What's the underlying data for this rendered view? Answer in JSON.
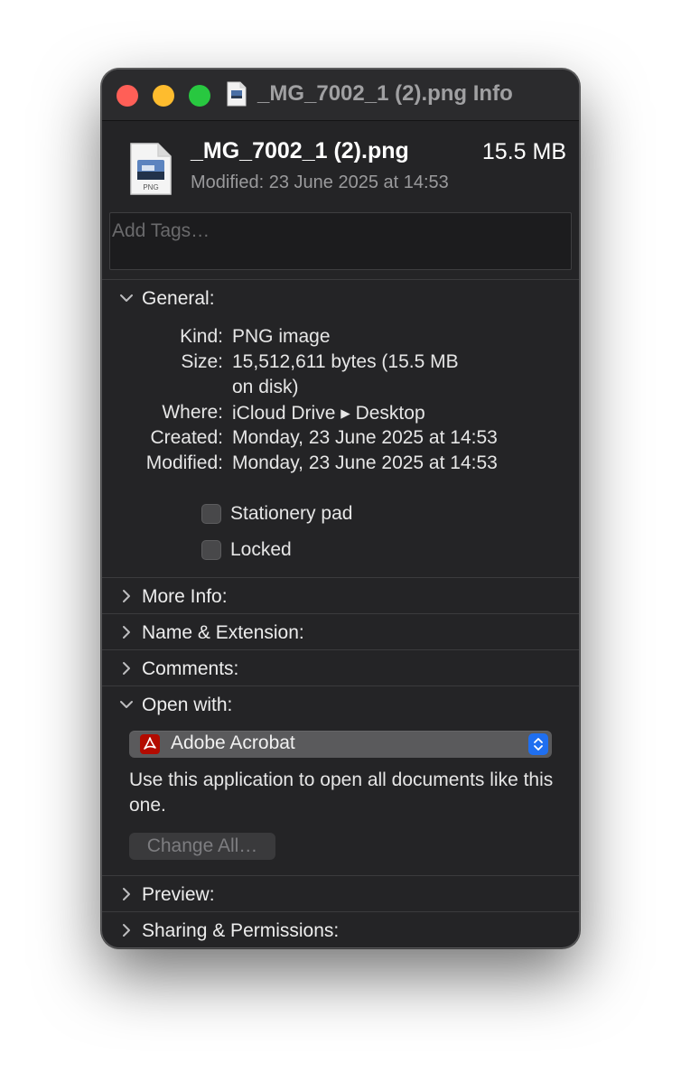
{
  "window": {
    "title": "_MG_7002_1 (2).png Info"
  },
  "file": {
    "name": "_MG_7002_1 (2).png",
    "size": "15.5 MB",
    "modified_label": "Modified:",
    "modified_value": "23 June 2025 at 14:53",
    "icon_badge": "PNG"
  },
  "tags": {
    "placeholder": "Add Tags…"
  },
  "general": {
    "header": "General:",
    "expanded": true,
    "rows": [
      {
        "label": "Kind:",
        "value": "PNG image"
      },
      {
        "label": "Size:",
        "value": "15,512,611 bytes (15.5 MB",
        "value2": "on disk)"
      },
      {
        "label": "Where:",
        "value": "iCloud Drive ▸ Desktop"
      },
      {
        "label": "Created:",
        "value": "Monday, 23 June 2025 at 14:53"
      },
      {
        "label": "Modified:",
        "value": "Monday, 23 June 2025 at 14:53"
      }
    ],
    "stationery_label": "Stationery pad",
    "stationery_checked": false,
    "locked_label": "Locked",
    "locked_checked": false
  },
  "sections": {
    "more_info": "More Info:",
    "name_extension": "Name & Extension:",
    "comments": "Comments:",
    "open_with": "Open with:",
    "preview": "Preview:",
    "sharing": "Sharing & Permissions:"
  },
  "open_with": {
    "app": "Adobe Acrobat",
    "description": "Use this application to open all documents like this one.",
    "change_all_label": "Change All…",
    "change_all_enabled": false
  },
  "colors": {
    "window_bg": "#242426",
    "close": "#ff5f57",
    "minimize": "#febc2e",
    "zoom": "#28c840",
    "accent": "#1f6ff0",
    "acrobat_red": "#b30b00"
  }
}
